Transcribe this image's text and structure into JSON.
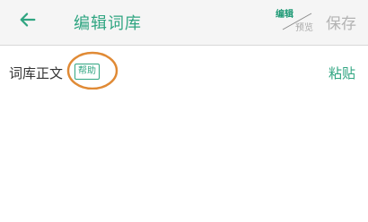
{
  "header": {
    "title": "编辑词库",
    "mode_toggle": {
      "edit": "编辑",
      "preview": "预览"
    },
    "save_label": "保存"
  },
  "content": {
    "section_label": "词库正文",
    "help_label": "帮助",
    "paste_label": "粘贴",
    "editor_text": ""
  },
  "colors": {
    "accent": "#2fa581",
    "disabled": "#b3b3b3",
    "highlight_ring": "#e08a35"
  },
  "icons": {
    "back": "arrow-left-icon"
  }
}
